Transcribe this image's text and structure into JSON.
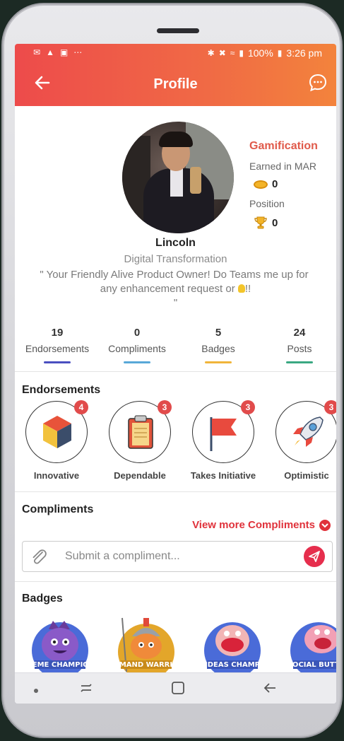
{
  "status": {
    "left_icons": [
      "mail-icon",
      "ai-icon",
      "image-icon",
      "more-dots-icon"
    ],
    "right_text": "✲ ✖ ≈ .ıl 100%",
    "battery": "100%",
    "time": "3:26 pm"
  },
  "header": {
    "title": "Profile"
  },
  "profile": {
    "name": "Lincoln",
    "role": "Digital Transformation",
    "bio_line1": "\" Your Friendly Alive Product Owner! Do Teams me up for",
    "bio_line2": "any enhancement request or",
    "bio_line2_suffix": "!!",
    "bio_line3": "\""
  },
  "gamification": {
    "title": "Gamification",
    "earned_label": "Earned in MAR",
    "earned_value": "0",
    "position_label": "Position",
    "position_value": "0"
  },
  "stats": [
    {
      "value": "19",
      "label": "Endorsements",
      "color": "#4a4fc0"
    },
    {
      "value": "0",
      "label": "Compliments",
      "color": "#58a8d8"
    },
    {
      "value": "5",
      "label": "Badges",
      "color": "#f0b53a"
    },
    {
      "value": "24",
      "label": "Posts",
      "color": "#3aa882"
    }
  ],
  "endorsements": {
    "title": "Endorsements",
    "items": [
      {
        "label": "Innovative",
        "count": "4",
        "icon": "cube-icon"
      },
      {
        "label": "Dependable",
        "count": "3",
        "icon": "clipboard-icon"
      },
      {
        "label": "Takes Initiative",
        "count": "3",
        "icon": "flag-icon"
      },
      {
        "label": "Optimistic",
        "count": "3",
        "icon": "rocket-icon"
      }
    ]
  },
  "compliments": {
    "title": "Compliments",
    "view_more": "View more Compliments",
    "placeholder": "Submit a compliment..."
  },
  "badges": {
    "title": "Badges",
    "items": [
      {
        "text": "MEME CHAMPION",
        "color": "#4a6bd8"
      },
      {
        "text": "DEMAND WARRIOR",
        "color": "#e3a62a"
      },
      {
        "text": "IDEAS CHAMP",
        "color": "#4a6bd8"
      },
      {
        "text": "SOCIAL BUTTER",
        "color": "#4a6bd8"
      }
    ]
  }
}
